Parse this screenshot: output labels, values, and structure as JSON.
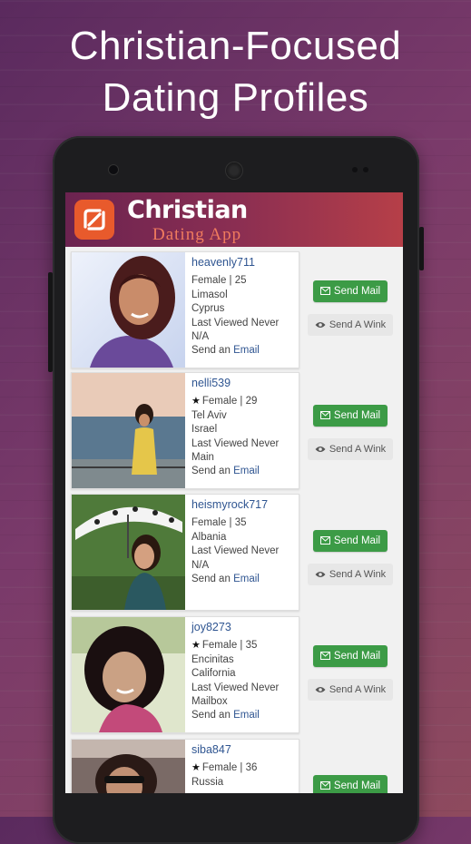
{
  "headline": {
    "line1": "Christian-Focused",
    "line2": "Dating Profiles"
  },
  "app": {
    "brand_line1": "Christian",
    "brand_line2": "Dating App"
  },
  "actions": {
    "mail_label": "Send Mail",
    "wink_label": "Send A Wink",
    "send_prefix": "Send an",
    "email_link": "Email"
  },
  "profiles": [
    {
      "username": "heavenly711",
      "gender_age": "Female | 25",
      "line3": "Limasol",
      "line4": "Cyprus",
      "last_viewed": "Last Viewed Never",
      "line6": "N/A",
      "starred": false
    },
    {
      "username": "nelli539",
      "gender_age": "Female | 29",
      "line3": "Tel Aviv",
      "line4": "Israel",
      "last_viewed": "Last Viewed Never",
      "line6": "Main",
      "starred": true
    },
    {
      "username": "heismyrock717",
      "gender_age": "Female | 35",
      "line3": "Albania",
      "line4": "Last Viewed Never",
      "last_viewed": "N/A",
      "line6": "",
      "starred": false
    },
    {
      "username": "joy8273",
      "gender_age": "Female | 35",
      "line3": "Encinitas",
      "line4": "California",
      "last_viewed": "Last Viewed Never",
      "line6": "Mailbox",
      "starred": true
    },
    {
      "username": "siba847",
      "gender_age": "Female | 36",
      "line3": "Russia",
      "line4": "",
      "last_viewed": "",
      "line6": "",
      "starred": true
    }
  ]
}
